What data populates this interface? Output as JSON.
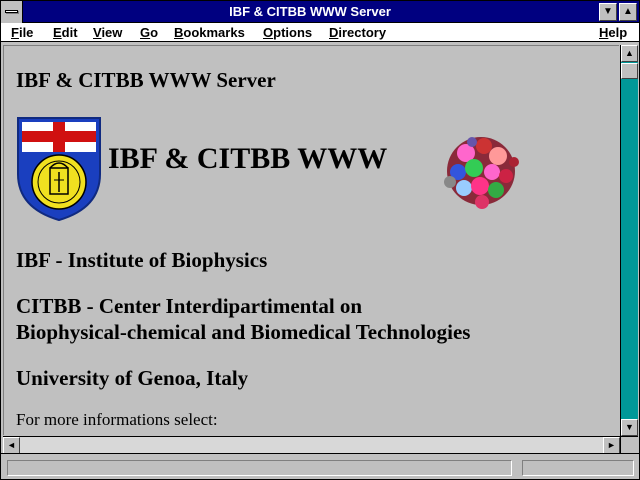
{
  "window": {
    "title": "IBF & CITBB WWW Server"
  },
  "menu": {
    "file": "File",
    "edit": "Edit",
    "view": "View",
    "go": "Go",
    "bookmarks": "Bookmarks",
    "options": "Options",
    "directory": "Directory",
    "help": "Help"
  },
  "page": {
    "heading": "IBF & CITBB WWW Server",
    "banner_title": "IBF & CITBB WWW",
    "institute": "IBF - Institute of Biophysics",
    "citbb_line1": "CITBB - Center Interdipartimental on",
    "citbb_line2": "Biophysical-chemical and Biomedical Technologies",
    "university": "University of Genoa, Italy",
    "more_info": "For more informations select:"
  },
  "status": {
    "text": ""
  },
  "colors": {
    "title_bar": "#000080",
    "content_bg": "#c0c0c0",
    "scrollbar_track": "#008080"
  }
}
